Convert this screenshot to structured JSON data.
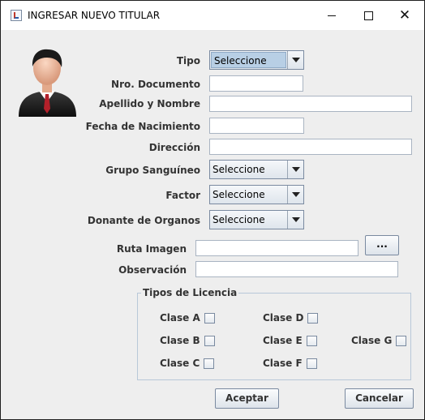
{
  "window": {
    "title": "INGRESAR NUEVO TITULAR"
  },
  "form": {
    "tipo": {
      "label": "Tipo",
      "value": "Seleccione"
    },
    "nro_documento": {
      "label": "Nro. Documento",
      "value": ""
    },
    "apellido_nombre": {
      "label": "Apellido y Nombre",
      "value": ""
    },
    "fecha_nacimiento": {
      "label": "Fecha de Nacimiento",
      "value": ""
    },
    "direccion": {
      "label": "Dirección",
      "value": ""
    },
    "grupo_sanguineo": {
      "label": "Grupo Sanguíneo",
      "value": "Seleccione"
    },
    "factor": {
      "label": "Factor",
      "value": "Seleccione"
    },
    "donante": {
      "label": "Donante de Organos",
      "value": "Seleccione"
    },
    "ruta_imagen": {
      "label": "Ruta Imagen",
      "value": "",
      "browse_label": "..."
    },
    "observacion": {
      "label": "Observación",
      "value": ""
    }
  },
  "licencias": {
    "title": "Tipos de Licencia",
    "items": [
      {
        "label": "Clase A",
        "checked": false
      },
      {
        "label": "Clase B",
        "checked": false
      },
      {
        "label": "Clase C",
        "checked": false
      },
      {
        "label": "Clase D",
        "checked": false
      },
      {
        "label": "Clase E",
        "checked": false
      },
      {
        "label": "Clase F",
        "checked": false
      },
      {
        "label": "Clase G",
        "checked": false
      }
    ]
  },
  "buttons": {
    "accept": "Aceptar",
    "cancel": "Cancelar"
  },
  "icons": {
    "app": "java-app-icon",
    "avatar": "user-avatar-icon",
    "minimize": "minimize-icon",
    "maximize": "maximize-icon",
    "close": "close-icon",
    "dropdown": "chevron-down-icon"
  },
  "colors": {
    "selected_combo": "#b8cfe5",
    "window_bg": "#eeeeee",
    "group_border": "#b8c8d8"
  }
}
